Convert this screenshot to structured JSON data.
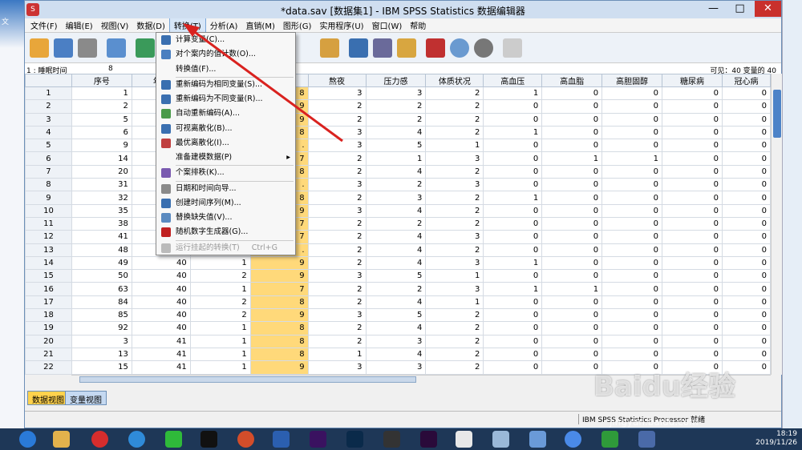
{
  "app": {
    "title": "*data.sav [数据集1] - IBM SPSS Statistics 数据编辑器",
    "icon": "spss-icon",
    "min": "—",
    "max": "□",
    "close": "✕"
  },
  "leftstrip": {
    "label": "文"
  },
  "menus": [
    "文件(F)",
    "编辑(E)",
    "视图(V)",
    "数据(D)",
    "转换(T)",
    "分析(A)",
    "直销(M)",
    "图形(G)",
    "实用程序(U)",
    "窗口(W)",
    "帮助"
  ],
  "cellbar": {
    "ref": "1 : 睡眠时间",
    "value": "8",
    "visible": "可见：40 变量的 40"
  },
  "columns": [
    "序号",
    "年龄",
    "性别",
    "睡眠",
    "熬夜",
    "压力感",
    "体质状况",
    "高血压",
    "高血脂",
    "高胆固醇",
    "糖尿病",
    "冠心病"
  ],
  "rows": [
    [
      "1",
      "1",
      "40",
      "1",
      "8",
      "3",
      "3",
      "2",
      "1",
      "0",
      "0",
      "0",
      "0"
    ],
    [
      "2",
      "2",
      "40",
      "2",
      "9",
      "2",
      "2",
      "2",
      "0",
      "0",
      "0",
      "0",
      "0"
    ],
    [
      "3",
      "5",
      "40",
      "1",
      "9",
      "2",
      "2",
      "2",
      "0",
      "0",
      "0",
      "0",
      "0"
    ],
    [
      "4",
      "6",
      "40",
      "1",
      "8",
      "3",
      "4",
      "2",
      "1",
      "0",
      "0",
      "0",
      "0"
    ],
    [
      "5",
      "9",
      "40",
      "2",
      ".",
      "3",
      "5",
      "1",
      "0",
      "0",
      "0",
      "0",
      "0"
    ],
    [
      "6",
      "14",
      "40",
      "1",
      "7",
      "2",
      "1",
      "3",
      "0",
      "1",
      "1",
      "0",
      "0"
    ],
    [
      "7",
      "20",
      "40",
      "2",
      "8",
      "2",
      "4",
      "2",
      "0",
      "0",
      "0",
      "0",
      "0"
    ],
    [
      "8",
      "31",
      "40",
      "2",
      ".",
      "3",
      "2",
      "3",
      "0",
      "0",
      "0",
      "0",
      "0"
    ],
    [
      "9",
      "32",
      "40",
      "2",
      "8",
      "2",
      "3",
      "2",
      "1",
      "0",
      "0",
      "0",
      "0"
    ],
    [
      "10",
      "35",
      "40",
      "2",
      "9",
      "3",
      "4",
      "2",
      "0",
      "0",
      "0",
      "0",
      "0"
    ],
    [
      "11",
      "38",
      "40",
      "2",
      "7",
      "2",
      "2",
      "2",
      "0",
      "0",
      "0",
      "0",
      "0"
    ],
    [
      "12",
      "41",
      "40",
      "2",
      "7",
      "2",
      "4",
      "3",
      "0",
      "0",
      "0",
      "0",
      "0"
    ],
    [
      "13",
      "48",
      "40",
      "2",
      ".",
      "2",
      "4",
      "2",
      "0",
      "0",
      "0",
      "0",
      "0"
    ],
    [
      "14",
      "49",
      "40",
      "1",
      "9",
      "2",
      "4",
      "3",
      "1",
      "0",
      "0",
      "0",
      "0"
    ],
    [
      "15",
      "50",
      "40",
      "2",
      "9",
      "3",
      "5",
      "1",
      "0",
      "0",
      "0",
      "0",
      "0"
    ],
    [
      "16",
      "63",
      "40",
      "1",
      "7",
      "2",
      "2",
      "3",
      "1",
      "1",
      "0",
      "0",
      "0"
    ],
    [
      "17",
      "84",
      "40",
      "2",
      "8",
      "2",
      "4",
      "1",
      "0",
      "0",
      "0",
      "0",
      "0"
    ],
    [
      "18",
      "85",
      "40",
      "2",
      "9",
      "3",
      "5",
      "2",
      "0",
      "0",
      "0",
      "0",
      "0"
    ],
    [
      "19",
      "92",
      "40",
      "1",
      "8",
      "2",
      "4",
      "2",
      "0",
      "0",
      "0",
      "0",
      "0"
    ],
    [
      "20",
      "3",
      "41",
      "1",
      "8",
      "2",
      "3",
      "2",
      "0",
      "0",
      "0",
      "0",
      "0"
    ],
    [
      "21",
      "13",
      "41",
      "1",
      "8",
      "1",
      "4",
      "2",
      "0",
      "0",
      "0",
      "0",
      "0"
    ],
    [
      "22",
      "15",
      "41",
      "1",
      "9",
      "3",
      "3",
      "2",
      "0",
      "0",
      "0",
      "0",
      "0"
    ]
  ],
  "dropdown": [
    {
      "label": "计算变量(C)...",
      "icon": "calculator-icon",
      "color": "#3a6fb0"
    },
    {
      "label": "对个案内的值计数(O)...",
      "icon": "count-icon",
      "color": "#4a7fc0"
    },
    {
      "label": "转换值(F)...",
      "icon": "shift-values-icon",
      "color": "#f7f7f7"
    },
    {
      "sep": true
    },
    {
      "label": "重新编码为相同变量(S)...",
      "icon": "recode-same-icon",
      "color": "#3a6fb0"
    },
    {
      "label": "重新编码为不同变量(R)...",
      "icon": "recode-different-icon",
      "color": "#3a6fb0"
    },
    {
      "label": "自动重新编码(A)...",
      "icon": "auto-recode-icon",
      "color": "#4a9a4a"
    },
    {
      "label": "可视离散化(B)...",
      "icon": "visual-binning-icon",
      "color": "#3a6fb0"
    },
    {
      "label": "最优离散化(I)...",
      "icon": "optimal-binning-icon",
      "color": "#c04040"
    },
    {
      "label": "准备建模数据(P)",
      "icon": "prepare-data-icon",
      "color": "#f7f7f7",
      "submenu": "▸"
    },
    {
      "sep": true
    },
    {
      "label": "个案排秩(K)...",
      "icon": "rank-cases-icon",
      "color": "#7a5ab0"
    },
    {
      "sep": true
    },
    {
      "label": "日期和时间向导...",
      "icon": "date-time-icon",
      "color": "#8a8a8a"
    },
    {
      "label": "创建时间序列(M)...",
      "icon": "time-series-icon",
      "color": "#3a6fb0"
    },
    {
      "label": "替换缺失值(V)...",
      "icon": "replace-missing-icon",
      "color": "#5a8ac0"
    },
    {
      "label": "随机数字生成器(G)...",
      "icon": "random-generator-icon",
      "color": "#c02020"
    },
    {
      "sep": true
    },
    {
      "label": "运行挂起的转换(T)",
      "icon": "run-pending-icon",
      "color": "#bbbbbb",
      "shortcut": "Ctrl+G",
      "disabled": true
    }
  ],
  "tabs": {
    "data_view": "数据视图",
    "variable_view": "变量视图"
  },
  "status": {
    "processor": "IBM SPSS Statistics Processor 就绪"
  },
  "taskbar": {
    "time": "18:19",
    "date": "2019/11/26"
  },
  "watermark": {
    "main": "Baidu经验",
    "sub": "jingyan.baidu.com"
  },
  "colors": {
    "highlight_column": "#ffd97a",
    "accent": "#3b78c3",
    "arrow": "#d9221f"
  }
}
